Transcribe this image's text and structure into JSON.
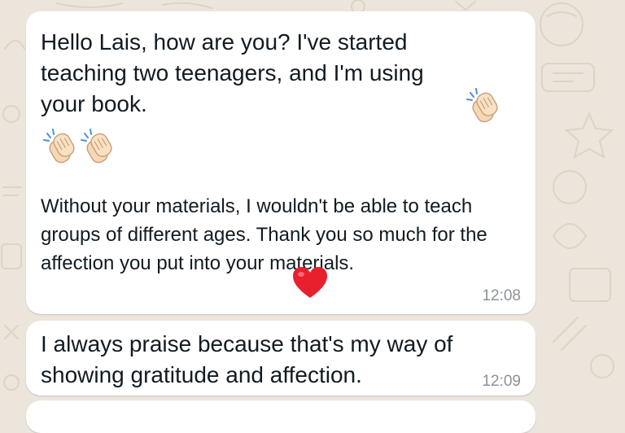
{
  "conversation": {
    "messages": [
      {
        "text": "Hello Lais, how are you? I've started teaching two teenagers, and I'm using your book.",
        "reactions": [
          "clapping-hands-emoji",
          "clapping-hands-emoji",
          "clapping-hands-emoji"
        ],
        "body": "Without your materials, I wouldn't be able to teach groups of different ages. Thank you so much for the affection you put into your materials.",
        "reaction": "red-heart-emoji",
        "time": "12:08"
      },
      {
        "text": "I always praise because that's my way of showing gratitude and affection.",
        "time": "12:09"
      }
    ]
  },
  "colors": {
    "wallpaper": "#ece5dc",
    "bubble": "#ffffff",
    "text": "#111b21",
    "timestamp": "#8a9298",
    "heart": "#e8202e",
    "clap_skin": "#f6d8b4"
  }
}
